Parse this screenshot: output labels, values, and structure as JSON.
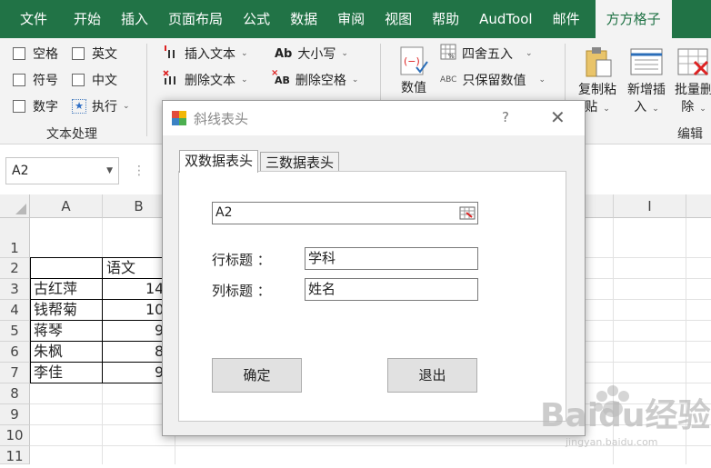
{
  "tabs": [
    "文件",
    "开始",
    "插入",
    "页面布局",
    "公式",
    "数据",
    "审阅",
    "视图",
    "帮助",
    "AudTool",
    "邮件",
    "方方格子"
  ],
  "ribbon": {
    "text_group": {
      "checks": [
        {
          "label": "空格"
        },
        {
          "label": "英文"
        },
        {
          "label": "符号"
        },
        {
          "label": "中文"
        },
        {
          "label": "数字"
        }
      ],
      "execute_label": "执行",
      "group_name": "文本处理"
    },
    "insert_text": "插入文本",
    "delete_text": "删除文本",
    "case_label": "大小写",
    "case_prefix": "Ab",
    "delete_space": "删除空格",
    "delete_space_prefix": "AB",
    "value_label": "数值",
    "round_label": "四舍五入",
    "keep_value": "只保留数值",
    "keep_value_prefix": "ABC",
    "copy_paste": [
      "复制粘",
      "贴"
    ],
    "new_insert": [
      "新增插",
      "入"
    ],
    "batch_delete": [
      "批量删",
      "除"
    ],
    "edit_group": "编辑"
  },
  "formula_bar": {
    "name_box": "A2"
  },
  "sheet": {
    "columns": [
      "A",
      "B",
      "I"
    ],
    "rows": [
      "1",
      "2",
      "3",
      "4",
      "5",
      "6",
      "7",
      "8",
      "9",
      "10",
      "11"
    ],
    "b2": "语文",
    "names": [
      "古红萍",
      "钱帮菊",
      "蒋琴",
      "朱枫",
      "李佳"
    ],
    "scores_partial": [
      "14",
      "10",
      "9",
      "8",
      "9"
    ]
  },
  "dialog": {
    "title": "斜线表头",
    "help": "?",
    "close": "✕",
    "tabs": [
      "双数据表头",
      "三数据表头"
    ],
    "ref_value": "A2",
    "row_title_label": "行标题 ：",
    "row_title_value": "学科",
    "col_title_label": "列标题 ：",
    "col_title_value": "姓名",
    "ok": "确定",
    "exit": "退出"
  },
  "watermark": {
    "brand": "Baidu经验",
    "url": "jingyan.baidu.com"
  }
}
